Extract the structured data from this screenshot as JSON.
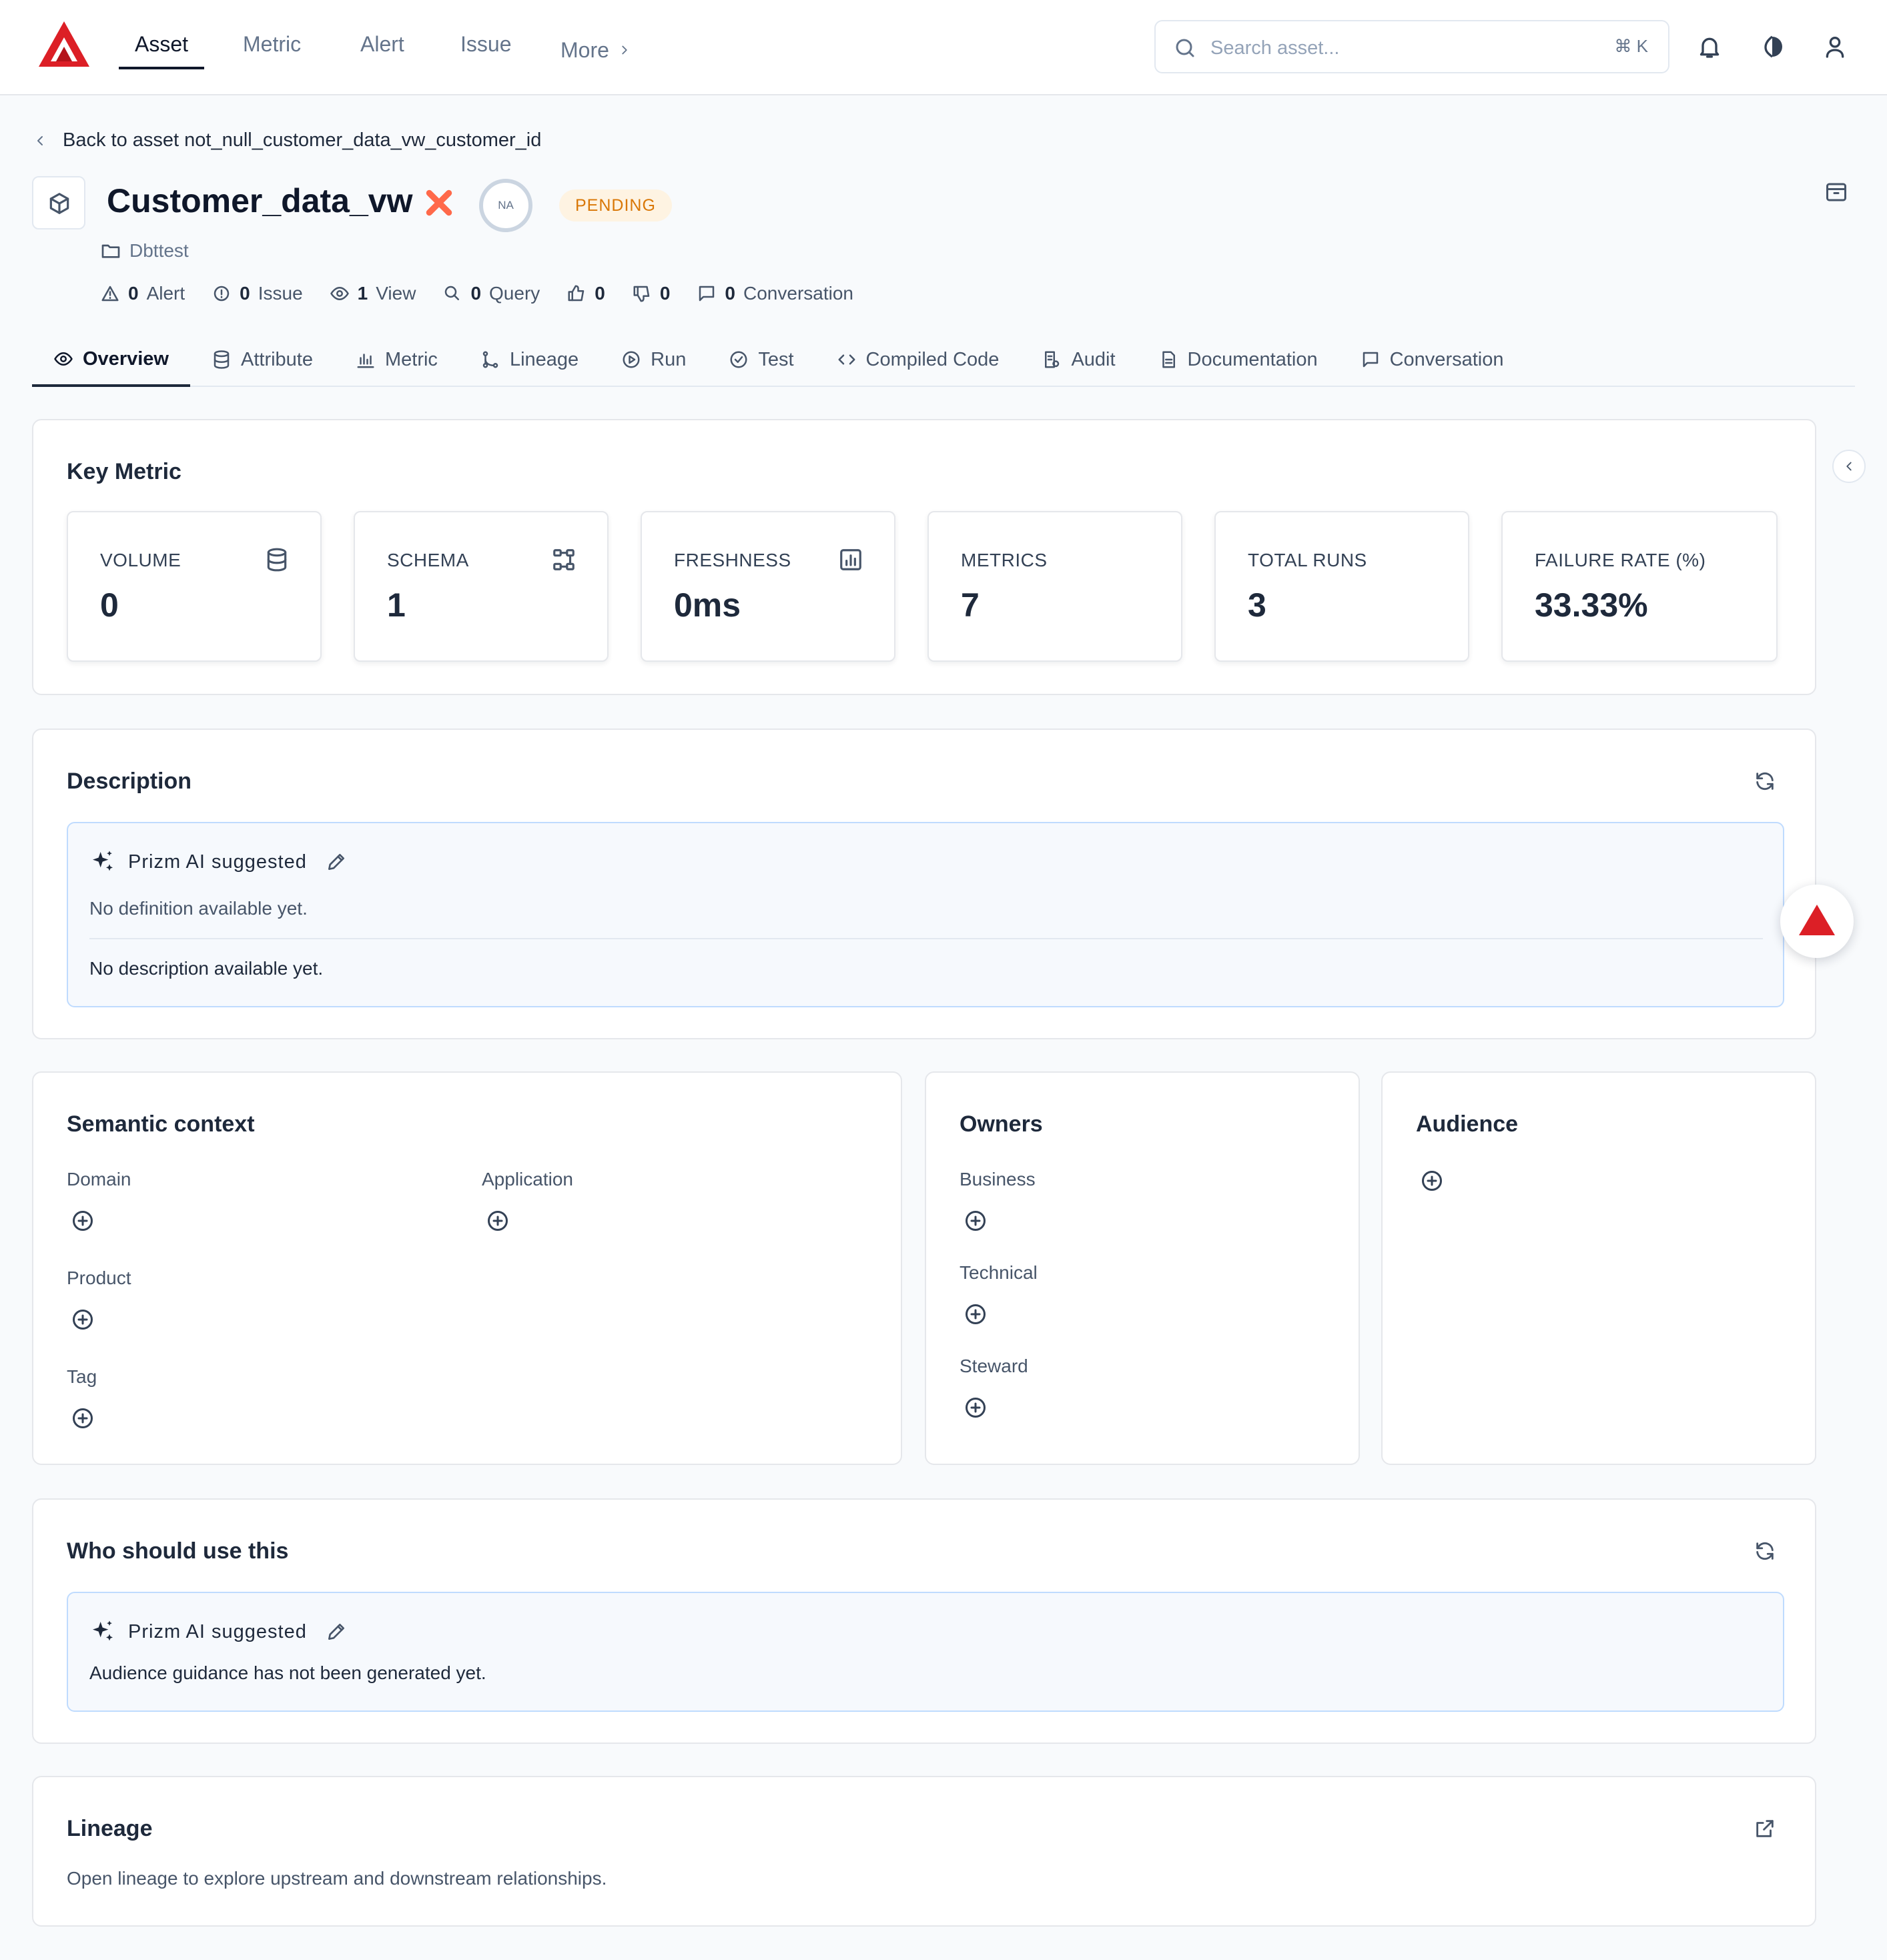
{
  "nav": {
    "tabs": [
      "Asset",
      "Metric",
      "Alert",
      "Issue"
    ],
    "more_label": "More",
    "search": {
      "placeholder": "Search asset...",
      "shortcut": "⌘ K"
    }
  },
  "header": {
    "back_link": "Back to asset not_null_customer_data_vw_customer_id",
    "title": "Customer_data_vw",
    "score_badge": "NA",
    "status": "PENDING",
    "folder": "Dbttest",
    "stats": {
      "alert_count": "0",
      "alert_label": "Alert",
      "issue_count": "0",
      "issue_label": "Issue",
      "view_count": "1",
      "view_label": "View",
      "query_count": "0",
      "query_label": "Query",
      "likes": "0",
      "dislikes": "0",
      "conversation_count": "0",
      "conversation_label": "Conversation"
    }
  },
  "tabs": [
    "Overview",
    "Attribute",
    "Metric",
    "Lineage",
    "Run",
    "Test",
    "Compiled Code",
    "Audit",
    "Documentation",
    "Conversation"
  ],
  "key_metric": {
    "title": "Key Metric",
    "cards": [
      {
        "label": "VOLUME",
        "value": "0",
        "icon": "database-icon"
      },
      {
        "label": "SCHEMA",
        "value": "1",
        "icon": "schema-icon"
      },
      {
        "label": "FRESHNESS",
        "value": "0ms",
        "icon": "chart-box-icon"
      },
      {
        "label": "METRICS",
        "value": "7"
      },
      {
        "label": "TOTAL RUNS",
        "value": "3"
      },
      {
        "label": "FAILURE RATE (%)",
        "value": "33.33%"
      }
    ]
  },
  "description": {
    "title": "Description",
    "ai_label": "Prizm AI suggested",
    "definition_text": "No definition available yet.",
    "description_text": "No description available yet."
  },
  "semantic_context": {
    "title": "Semantic context",
    "domain_label": "Domain",
    "application_label": "Application",
    "product_label": "Product",
    "tag_label": "Tag"
  },
  "owners": {
    "title": "Owners",
    "business_label": "Business",
    "technical_label": "Technical",
    "steward_label": "Steward"
  },
  "audience": {
    "title": "Audience"
  },
  "who_should_use": {
    "title": "Who should use this",
    "ai_label": "Prizm AI suggested",
    "text": "Audience guidance has not been generated yet."
  },
  "lineage": {
    "title": "Lineage",
    "text": "Open lineage to explore upstream and downstream relationships."
  },
  "colors": {
    "brand_red": "#dc1f26",
    "pending_text": "#d97706",
    "pending_bg": "#fef3e2",
    "dbt_orange": "#ff694a",
    "ai_border": "#bfdbfe"
  }
}
